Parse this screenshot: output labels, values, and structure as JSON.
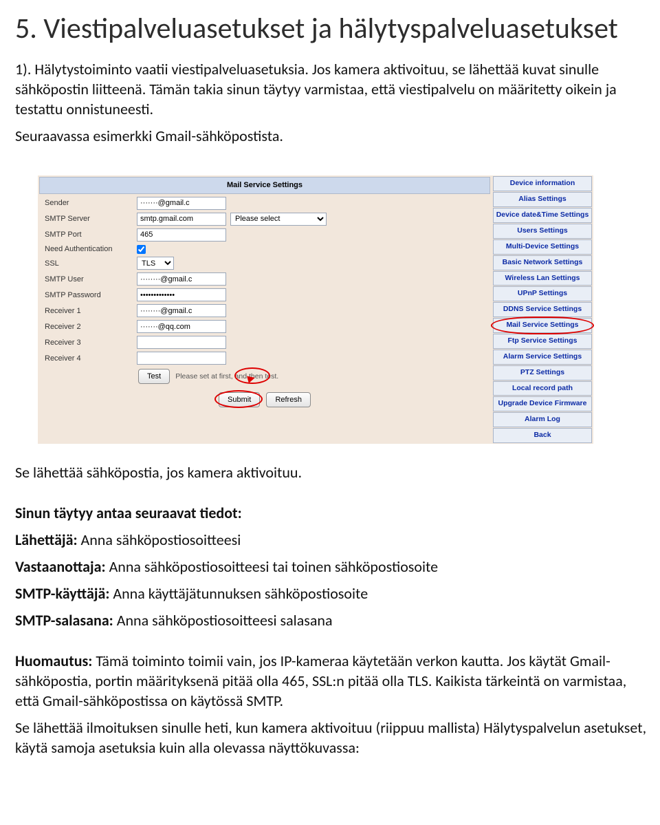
{
  "heading": "5. Viestipalveluasetukset ja hälytyspalveluasetukset",
  "intro_para": "1).   Hälytystoiminto vaatii viestipalveluasetuksia. Jos kamera aktivoituu, se lähettää kuvat sinulle sähköpostin liitteenä. Tämän takia sinun täytyy varmistaa, että viestipalvelu on määritetty oikein ja testattu onnistuneesti.",
  "intro_para2": "Seuraavassa esimerkki Gmail-sähköpostista.",
  "screenshot": {
    "header": "Mail Service Settings",
    "rows": {
      "sender_label": "Sender",
      "sender_value": "·······@gmail.c",
      "smtp_server_label": "SMTP Server",
      "smtp_server_value": "smtp.gmail.com",
      "smtp_select_label": "Please select",
      "smtp_port_label": "SMTP Port",
      "smtp_port_value": "465",
      "need_auth_label": "Need Authentication",
      "ssl_label": "SSL",
      "ssl_value": "TLS",
      "smtp_user_label": "SMTP User",
      "smtp_user_value": "········@gmail.c",
      "smtp_pass_label": "SMTP Password",
      "smtp_pass_value": "•••••••••••••",
      "recv1_label": "Receiver 1",
      "recv1_value": "········@gmail.c",
      "recv2_label": "Receiver 2",
      "recv2_value": "·······@qq.com",
      "recv3_label": "Receiver 3",
      "recv4_label": "Receiver 4"
    },
    "test_btn": "Test",
    "test_hint": "Please set at first, and then test.",
    "submit_btn": "Submit",
    "refresh_btn": "Refresh",
    "menu": [
      "Device information",
      "Alias Settings",
      "Device date&Time Settings",
      "Users Settings",
      "Multi-Device Settings",
      "Basic Network Settings",
      "Wireless Lan Settings",
      "UPnP Settings",
      "DDNS Service Settings",
      "Mail Service Settings",
      "Ftp Service Settings",
      "Alarm Service Settings",
      "PTZ Settings",
      "Local record path",
      "Upgrade Device Firmware",
      "Alarm Log",
      "Back"
    ],
    "menu_highlight_index": 9
  },
  "after_shot": "Se lähettää sähköpostia, jos kamera aktivoituu.",
  "need_title": "Sinun täytyy antaa seuraavat tiedot:",
  "need": [
    {
      "b": "Lähettäjä:",
      "t": " Anna sähköpostiosoitteesi"
    },
    {
      "b": "Vastaanottaja:",
      "t": " Anna sähköpostiosoitteesi tai toinen sähköpostiosoite"
    },
    {
      "b": "SMTP-käyttäjä:",
      "t": " Anna käyttäjätunnuksen sähköpostiosoite"
    },
    {
      "b": "SMTP-salasana:",
      "t": " Anna sähköpostiosoitteesi salasana"
    }
  ],
  "note_label": "Huomautus:",
  "note_body": " Tämä toiminto toimii vain, jos IP-kameraa käytetään verkon kautta. Jos käytät Gmail-sähköpostia, portin määrityksenä pitää olla 465, SSL:n pitää olla TLS. Kaikista tärkeintä on varmistaa, että Gmail-sähköpostissa on käytössä SMTP.",
  "note_line2": "Se lähettää ilmoituksen sinulle heti, kun kamera aktivoituu (riippuu mallista) Hälytyspalvelun asetukset, käytä samoja asetuksia kuin alla olevassa näyttökuvassa:"
}
